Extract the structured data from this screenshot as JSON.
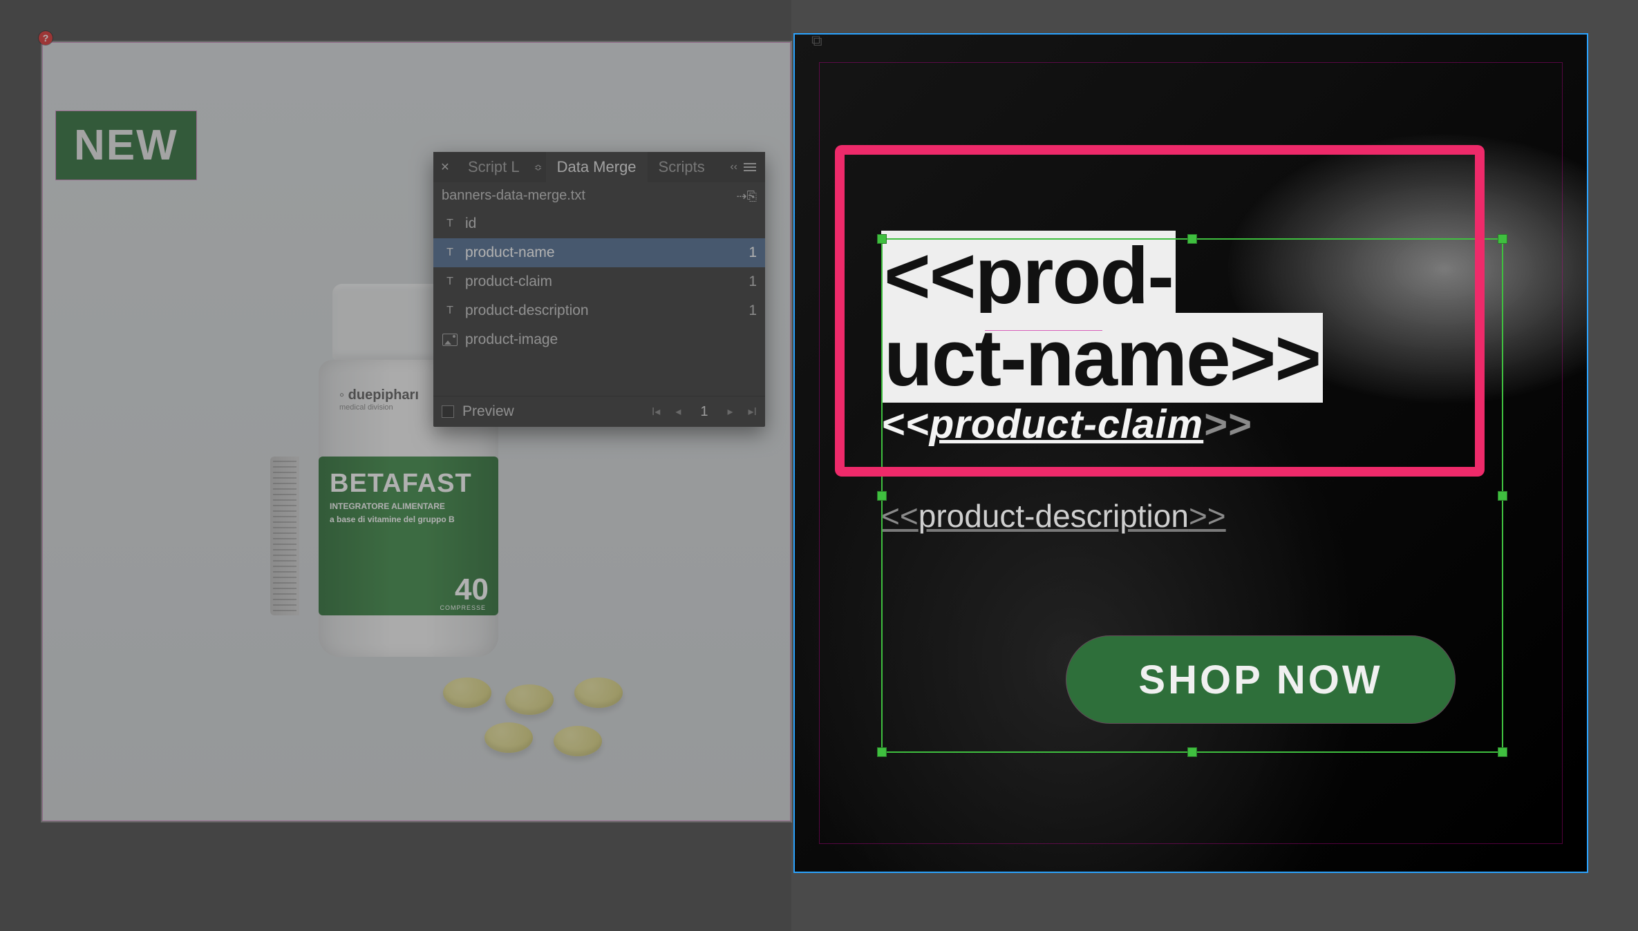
{
  "left_doc": {
    "badge": "NEW",
    "brand_line1": "◦ duepipharı",
    "brand_line2": "medical division",
    "label_title": "BETAFAST",
    "label_sub1": "INTEGRATORE ALIMENTARE",
    "label_sub2": "a base di vitamine del gruppo B",
    "label_count": "40",
    "label_unit": "COMPRESSE"
  },
  "panel": {
    "tabs": {
      "label": "Script L",
      "merge": "Data Merge",
      "scripts": "Scripts"
    },
    "file": "banners-data-merge.txt",
    "fields": [
      {
        "type": "T",
        "name": "id",
        "count": ""
      },
      {
        "type": "T",
        "name": "product-name",
        "count": "1",
        "selected": true
      },
      {
        "type": "T",
        "name": "product-claim",
        "count": "1"
      },
      {
        "type": "T",
        "name": "product-description",
        "count": "1"
      },
      {
        "type": "I",
        "name": "product-image",
        "count": ""
      }
    ],
    "preview": "Preview",
    "page": "1"
  },
  "right_doc": {
    "product_name_line1": "<<prod-",
    "product_name_line2": "uct-name>>",
    "claim_open": "<<",
    "claim_text": "product-claim",
    "claim_close": ">>",
    "desc_open": "<<",
    "desc_text": "product-description",
    "desc_close": ">>",
    "cta": "SHOP NOW"
  }
}
